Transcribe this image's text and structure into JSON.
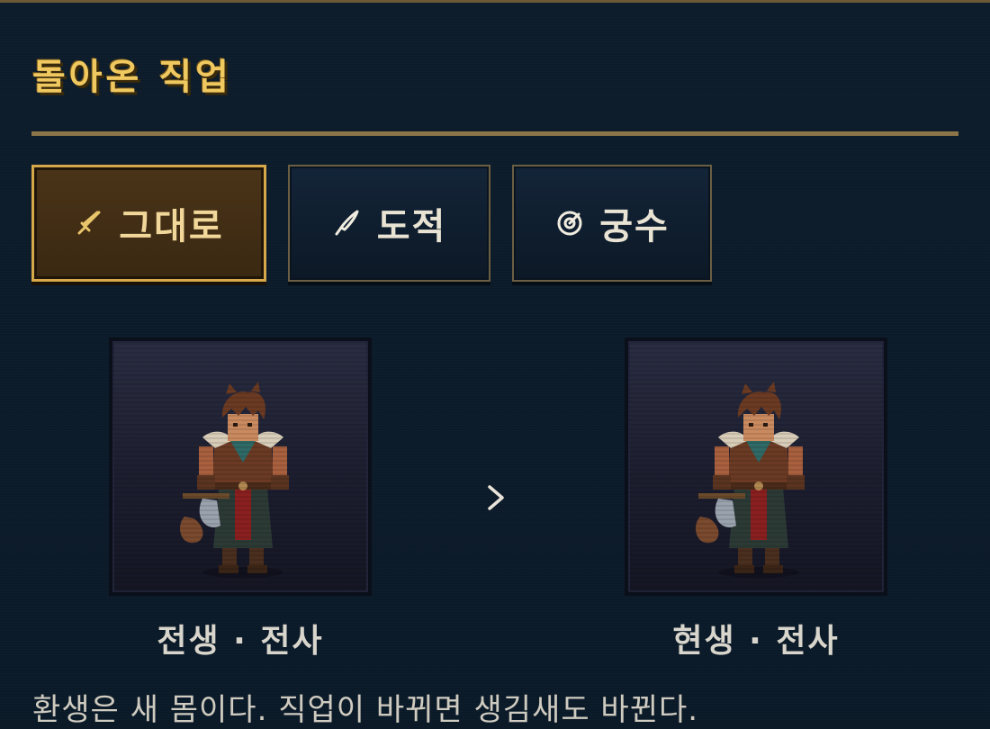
{
  "title": "돌아온 직업",
  "tabs": [
    {
      "label": "그대로",
      "icon": "sword-icon",
      "active": true
    },
    {
      "label": "도적",
      "icon": "dagger-icon",
      "active": false
    },
    {
      "label": "궁수",
      "icon": "target-icon",
      "active": false
    }
  ],
  "comparison": {
    "before": {
      "caption": "전생 · 전사",
      "sprite": "wolf-warrior-sprite"
    },
    "after": {
      "caption": "현생 · 전사",
      "sprite": "wolf-warrior-sprite"
    },
    "arrow": "chevron-right-icon"
  },
  "description": "환생은 새 몸이다. 직업이 바뀌면 생김새도 바뀐다.",
  "colors": {
    "gold": "#f0c860",
    "active_tab_bg": "#4a3418",
    "panel_bg": "#0c1a28"
  }
}
